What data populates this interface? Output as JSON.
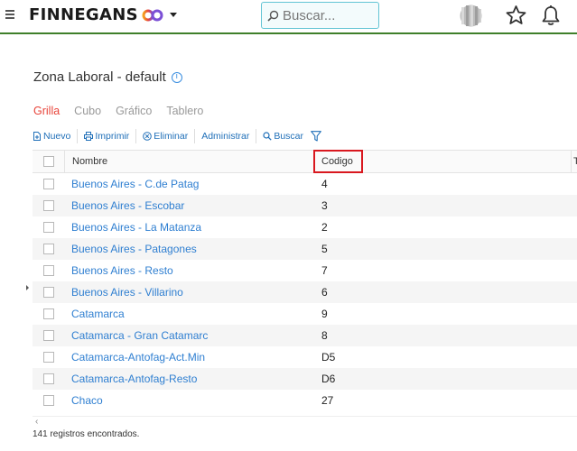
{
  "header": {
    "brand": "FINNEGANS",
    "search_placeholder": "Buscar..."
  },
  "page": {
    "title": "Zona Laboral - default"
  },
  "tabs": [
    {
      "label": "Grilla",
      "active": true
    },
    {
      "label": "Cubo",
      "active": false
    },
    {
      "label": "Gráfico",
      "active": false
    },
    {
      "label": "Tablero",
      "active": false
    }
  ],
  "toolbar": {
    "new_label": "Nuevo",
    "print_label": "Imprimir",
    "delete_label": "Eliminar",
    "manage_label": "Administrar",
    "search_label": "Buscar"
  },
  "grid": {
    "columns": [
      "Nombre",
      "Codigo",
      "T"
    ],
    "rows": [
      {
        "nombre": "Buenos Aires - C.de Patag",
        "codigo": "4"
      },
      {
        "nombre": "Buenos Aires - Escobar",
        "codigo": "3"
      },
      {
        "nombre": "Buenos Aires - La Matanza",
        "codigo": "2"
      },
      {
        "nombre": "Buenos Aires - Patagones",
        "codigo": "5"
      },
      {
        "nombre": "Buenos Aires - Resto",
        "codigo": "7"
      },
      {
        "nombre": "Buenos Aires - Villarino",
        "codigo": "6"
      },
      {
        "nombre": "Catamarca",
        "codigo": "9"
      },
      {
        "nombre": "Catamarca - Gran Catamarc",
        "codigo": "8"
      },
      {
        "nombre": "Catamarca-Antofag-Act.Min",
        "codigo": "D5"
      },
      {
        "nombre": "Catamarca-Antofag-Resto",
        "codigo": "D6"
      },
      {
        "nombre": "Chaco",
        "codigo": "27"
      }
    ]
  },
  "footer": {
    "record_count": "141 registros encontrados."
  },
  "colors": {
    "accent_green": "#3f7f2a",
    "link_blue": "#2f7fd1",
    "active_tab_red": "#e8443a",
    "highlight_red": "#d9181f",
    "search_border": "#62c4d4"
  }
}
